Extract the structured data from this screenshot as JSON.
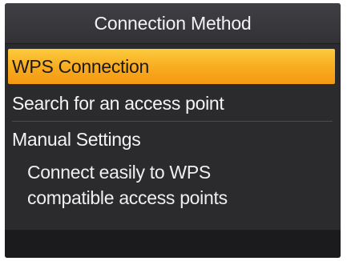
{
  "header": {
    "title": "Connection Method"
  },
  "menu": {
    "items": [
      {
        "label": "WPS Connection",
        "selected": true
      },
      {
        "label": "Search for an access point",
        "selected": false
      },
      {
        "label": "Manual Settings",
        "selected": false
      }
    ]
  },
  "description": {
    "line1": "Connect easily to WPS",
    "line2": "compatible access points"
  },
  "colors": {
    "highlight": "#f9aa1f",
    "background": "#2b2b2d",
    "text": "#f4f4f4"
  }
}
